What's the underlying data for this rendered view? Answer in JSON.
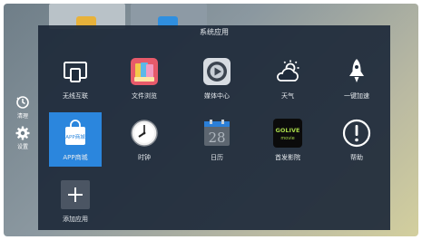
{
  "panel": {
    "title": "系统应用"
  },
  "side": {
    "cleanup_label": "清理",
    "settings_label": "设置"
  },
  "apps": [
    {
      "name": "无线互联"
    },
    {
      "name": "文件浏览"
    },
    {
      "name": "媒体中心"
    },
    {
      "name": "天气"
    },
    {
      "name": "一键加速"
    },
    {
      "name": "APP商城",
      "icon_text": "APP商城"
    },
    {
      "name": "时钟"
    },
    {
      "name": "日历",
      "icon_text": "28"
    },
    {
      "name": "首发影院",
      "icon_text_top": "GOLIVE",
      "icon_text_bottom": "movie"
    },
    {
      "name": "帮助"
    },
    {
      "name": "添加应用"
    }
  ],
  "colors": {
    "panel_bg": "#1e2a3a",
    "selected": "#2b86dd"
  }
}
